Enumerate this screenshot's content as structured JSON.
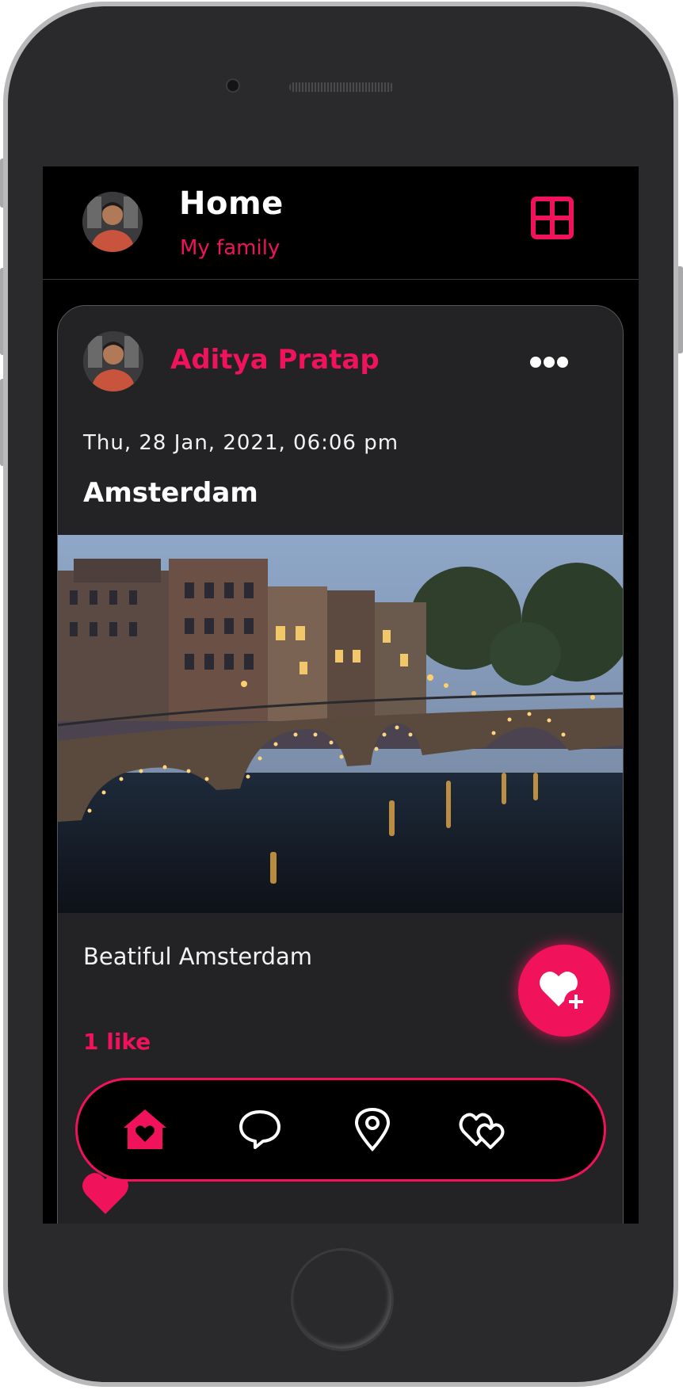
{
  "colors": {
    "accent": "#f0125b",
    "background": "#000000",
    "card": "#232325",
    "text": "#ffffff"
  },
  "header": {
    "title": "Home",
    "subtitle": "My family",
    "avatar_icon": "user-avatar",
    "menu_icon": "grid-icon"
  },
  "post": {
    "author": "Aditya Pratap",
    "date": "Thu, 28 Jan, 2021, 06:06 pm",
    "title": "Amsterdam",
    "image": "amsterdam-canal-bridge-photo",
    "caption": "Beatiful Amsterdam",
    "likes": "1 like",
    "more_icon": "more-horizontal-icon",
    "like_button_icon": "heart-plus-icon"
  },
  "bottom_nav": [
    {
      "name": "home",
      "icon": "home-icon",
      "active": true
    },
    {
      "name": "chat",
      "icon": "chat-bubble-icon",
      "active": false
    },
    {
      "name": "location",
      "icon": "location-pin-icon",
      "active": false
    },
    {
      "name": "favorites",
      "icon": "hearts-icon",
      "active": false
    }
  ]
}
